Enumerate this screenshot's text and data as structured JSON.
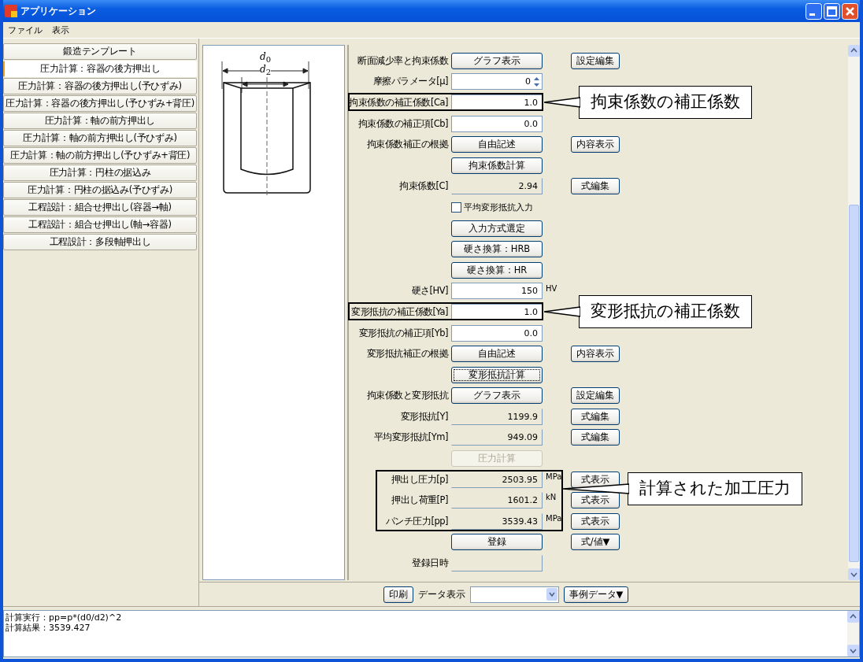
{
  "window": {
    "title": "アプリケーション"
  },
  "menu": [
    "ファイル",
    "表示"
  ],
  "sidebar": {
    "items": [
      {
        "label": "鍛造テンプレート",
        "selected": false
      },
      {
        "label": "圧力計算：容器の後方押出し",
        "selected": true
      },
      {
        "label": "圧力計算：容器の後方押出し(予ひずみ)",
        "selected": false
      },
      {
        "label": "圧力計算：容器の後方押出し(予ひずみ+背圧)",
        "selected": false
      },
      {
        "label": "圧力計算：軸の前方押出し",
        "selected": false
      },
      {
        "label": "圧力計算：軸の前方押出し(予ひずみ)",
        "selected": false
      },
      {
        "label": "圧力計算：軸の前方押出し(予ひずみ+背圧)",
        "selected": false
      },
      {
        "label": "圧力計算：円柱の据込み",
        "selected": false
      },
      {
        "label": "圧力計算：円柱の据込み(予ひずみ)",
        "selected": false
      },
      {
        "label": "工程設計：組合せ押出し(容器→軸)",
        "selected": false
      },
      {
        "label": "工程設計：組合せ押出し(軸→容器)",
        "selected": false
      },
      {
        "label": "工程設計：多段軸押出し",
        "selected": false
      }
    ]
  },
  "diagram": {
    "outer_label": "*d*$_{0}$",
    "inner_label": "*d*$_{2}$"
  },
  "form": {
    "blocks": [
      {
        "rows": [
          {
            "label": "断面減少率と拘束係数",
            "button": {
              "label": "グラフ表示",
              "disabled": false,
              "focused": false
            },
            "side_button": "設定編集"
          },
          {
            "label": "摩擦パラメータ[μ]",
            "field": {
              "kind": "spinner",
              "value": "0"
            }
          }
        ]
      },
      {
        "callout": "拘束係数の補正係数",
        "rows": [
          {
            "label": "拘束係数の補正係数[Ca]",
            "field": {
              "kind": "input",
              "value": "1.0"
            }
          }
        ]
      },
      {
        "rows": [
          {
            "label": "拘束係数の補正項[Cb]",
            "field": {
              "kind": "input",
              "value": "0.0"
            }
          },
          {
            "label": "拘束係数補正の根拠",
            "button": {
              "label": "自由記述",
              "disabled": false,
              "focused": false
            },
            "side_button": "内容表示"
          },
          {
            "button": {
              "label": "拘束係数計算",
              "disabled": false,
              "focused": false
            }
          },
          {
            "label": "拘束係数[C]",
            "field": {
              "kind": "readonly",
              "value": "2.94"
            },
            "side_button": "式編集"
          },
          {
            "check": {
              "label": "平均変形抵抗入力",
              "checked": false
            }
          },
          {
            "button": {
              "label": "入力方式選定",
              "disabled": false,
              "focused": false
            }
          },
          {
            "button": {
              "label": "硬さ換算：HRB",
              "disabled": false,
              "focused": false
            }
          },
          {
            "button": {
              "label": "硬さ換算：HR",
              "disabled": false,
              "focused": false
            }
          },
          {
            "label": "硬さ[HV]",
            "field": {
              "kind": "input",
              "value": "150"
            },
            "unit": "HV"
          }
        ]
      },
      {
        "callout": "変形抵抗の補正係数",
        "rows": [
          {
            "label": "変形抵抗の補正係数[Ya]",
            "field": {
              "kind": "input",
              "value": "1.0"
            }
          }
        ]
      },
      {
        "rows": [
          {
            "label": "変形抵抗の補正項[Yb]",
            "field": {
              "kind": "input",
              "value": "0.0"
            }
          },
          {
            "label": "変形抵抗補正の根拠",
            "button": {
              "label": "自由記述",
              "disabled": false,
              "focused": false
            },
            "side_button": "内容表示"
          },
          {
            "button": {
              "label": "変形抵抗計算",
              "disabled": false,
              "focused": true
            }
          },
          {
            "label": "拘束係数と変形抵抗",
            "button": {
              "label": "グラフ表示",
              "disabled": false,
              "focused": false
            },
            "side_button": "設定編集"
          },
          {
            "label": "変形抵抗[Y]",
            "field": {
              "kind": "readonly",
              "value": "1199.9"
            },
            "side_button": "式編集"
          },
          {
            "label": "平均変形抵抗[Ym]",
            "field": {
              "kind": "readonly",
              "value": "949.09"
            },
            "side_button": "式編集"
          },
          {
            "button": {
              "label": "圧力計算",
              "disabled": true,
              "focused": false
            }
          }
        ]
      },
      {
        "callout": "計算された加工圧力",
        "rows": [
          {
            "label": "押出し圧力[p]",
            "field": {
              "kind": "readonly",
              "value": "2503.95"
            },
            "unit": "MPa",
            "side_button": "式表示"
          },
          {
            "label": "押出し荷重[P]",
            "field": {
              "kind": "readonly",
              "value": "1601.2"
            },
            "unit": "kN",
            "side_button": "式表示"
          },
          {
            "label": "パンチ圧力[pp]",
            "field": {
              "kind": "readonly",
              "value": "3539.43"
            },
            "unit": "MPa",
            "side_button": "式表示"
          }
        ]
      },
      {
        "rows": [
          {
            "button": {
              "label": "登録",
              "disabled": false,
              "focused": false
            },
            "side_button": "式/値▼"
          },
          {
            "label": "登録日時",
            "field": {
              "kind": "readonly"
            }
          }
        ]
      }
    ]
  },
  "toolbar": {
    "print_button": "印刷",
    "data_label": "データ表示",
    "example_button": "事例データ▼"
  },
  "log": [
    "計算実行：pp=p*(d0/d2)^2",
    "計算結果：3539.427"
  ]
}
